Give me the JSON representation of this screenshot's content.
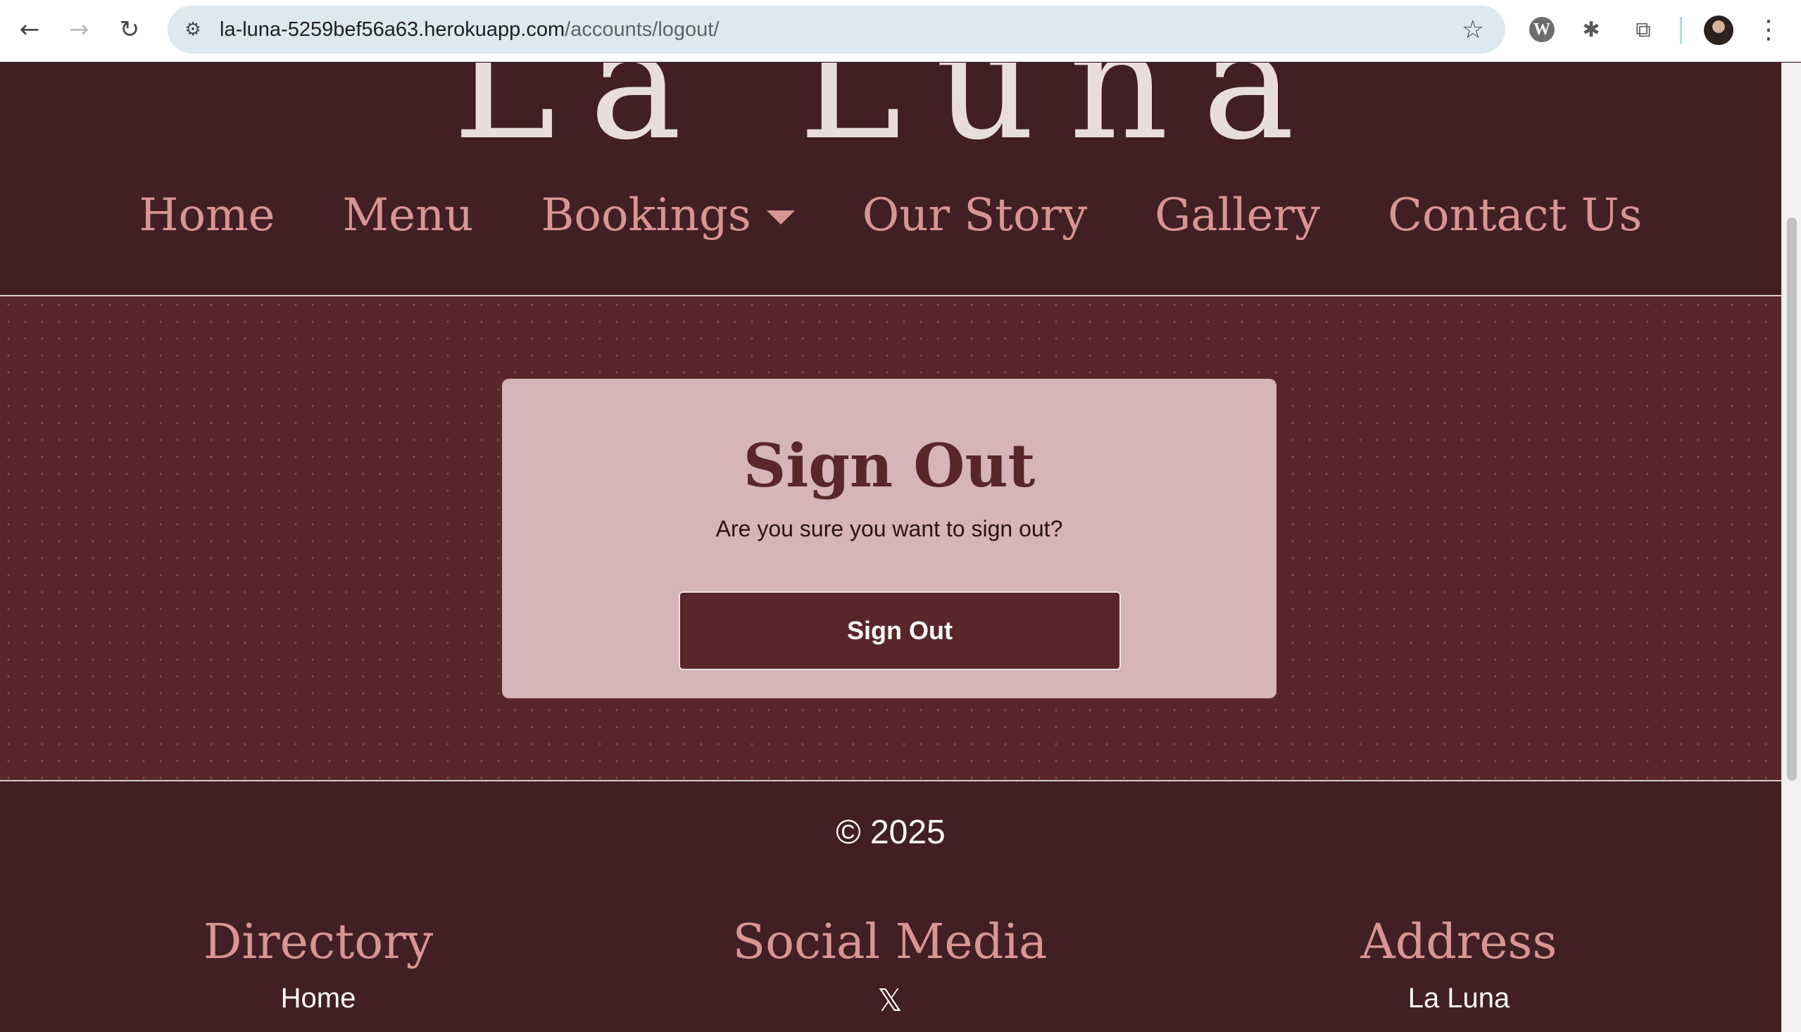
{
  "browser": {
    "url_host": "la-luna-5259bef56a63.herokuapp.com",
    "url_path": "/accounts/logout/",
    "back_icon": "arrow-left-icon",
    "forward_icon": "arrow-right-icon",
    "reload_icon": "reload-icon",
    "site_settings_icon": "tune-icon",
    "bookmark_icon": "star-icon",
    "extensions": [
      "w-extension-icon",
      "bug-extension-icon",
      "puzzle-extensions-icon"
    ],
    "menu_icon": "kebab-menu-icon"
  },
  "site": {
    "brand": "La Luna",
    "nav": [
      {
        "label": "Home"
      },
      {
        "label": "Menu"
      },
      {
        "label": "Bookings"
      },
      {
        "label": "Our Story"
      },
      {
        "label": "Gallery"
      },
      {
        "label": "Contact Us"
      }
    ]
  },
  "signout": {
    "title": "Sign Out",
    "question": "Are you sure you want to sign out?",
    "button": "Sign Out"
  },
  "footer": {
    "copyright": "© 2025",
    "directory": {
      "heading": "Directory",
      "first_item": "Home"
    },
    "social": {
      "heading": "Social Media",
      "first_item_icon": "x-twitter-icon"
    },
    "address": {
      "heading": "Address",
      "first_line": "La Luna"
    }
  },
  "colors": {
    "header_bg": "#421f23",
    "content_bg": "#592629",
    "card_bg": "#d6b4b7",
    "accent": "#d89592"
  }
}
